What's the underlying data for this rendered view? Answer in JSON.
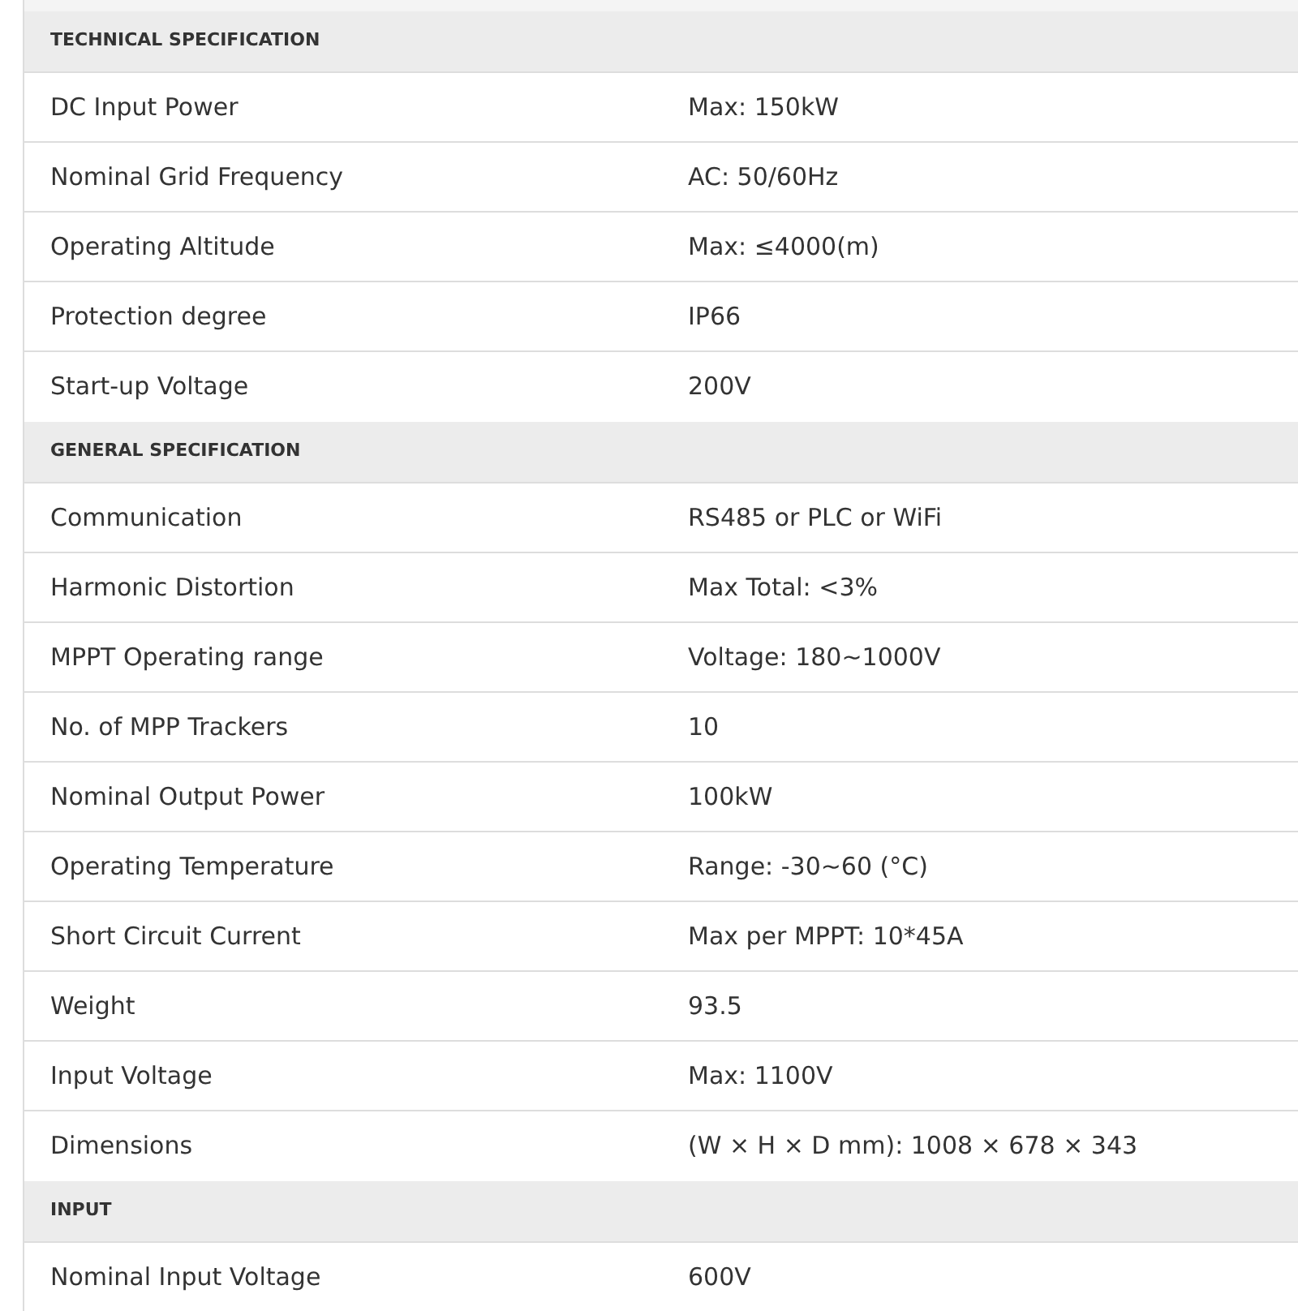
{
  "sections": [
    {
      "title": "TECHNICAL SPECIFICATION",
      "rows": [
        {
          "label": "DC Input Power",
          "value": "Max: 150kW"
        },
        {
          "label": "Nominal Grid Frequency",
          "value": "AC: 50/60Hz"
        },
        {
          "label": "Operating Altitude",
          "value": "Max: ≤4000(m)"
        },
        {
          "label": "Protection degree",
          "value": "IP66"
        },
        {
          "label": "Start-up Voltage",
          "value": "200V"
        }
      ]
    },
    {
      "title": "GENERAL SPECIFICATION",
      "rows": [
        {
          "label": "Communication",
          "value": "RS485 or PLC or WiFi"
        },
        {
          "label": "Harmonic Distortion",
          "value": "Max Total: <3%"
        },
        {
          "label": "MPPT Operating range",
          "value": "Voltage: 180~1000V"
        },
        {
          "label": "No. of MPP Trackers",
          "value": "10"
        },
        {
          "label": "Nominal Output Power",
          "value": "100kW"
        },
        {
          "label": "Operating Temperature",
          "value": "Range: -30~60 (°C)"
        },
        {
          "label": "Short Circuit Current",
          "value": "Max per MPPT: 10*45A"
        },
        {
          "label": "Weight",
          "value": "93.5"
        },
        {
          "label": "Input Voltage",
          "value": "Max: 1100V"
        },
        {
          "label": "Dimensions",
          "value": "(W × H × D mm): 1008 × 678 × 343"
        }
      ]
    },
    {
      "title": "INPUT",
      "rows": [
        {
          "label": "Nominal Input Voltage",
          "value": "600V"
        }
      ]
    }
  ]
}
